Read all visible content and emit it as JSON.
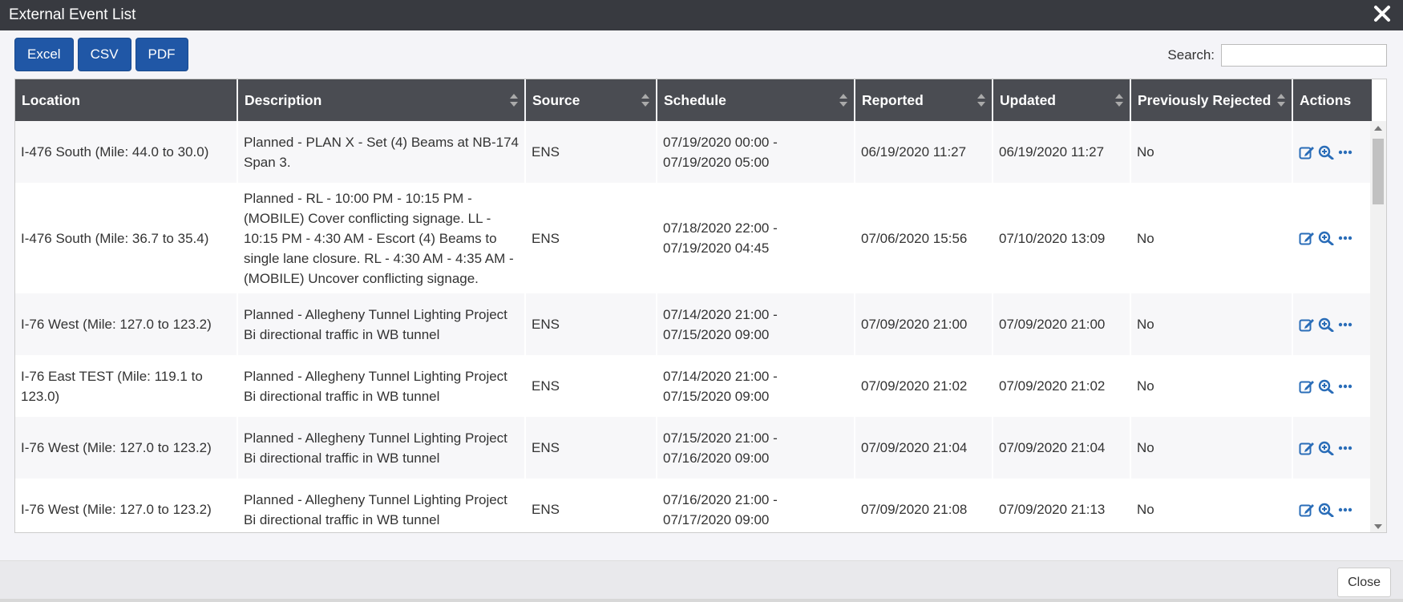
{
  "dialog": {
    "title": "External Event List",
    "close_icon": "close-icon"
  },
  "toolbar": {
    "buttons": [
      {
        "label": "Excel"
      },
      {
        "label": "CSV"
      },
      {
        "label": "PDF"
      }
    ]
  },
  "search": {
    "label": "Search:",
    "value": "",
    "placeholder": ""
  },
  "table": {
    "columns": [
      "Location",
      "Description",
      "Source",
      "Schedule",
      "Reported",
      "Updated",
      "Previously Rejected",
      "Actions"
    ],
    "rows": [
      {
        "location": "I-476 South (Mile: 44.0 to 30.0)",
        "description": "Planned - PLAN X - Set (4) Beams at NB-174 Span 3.",
        "source": "ENS",
        "schedule": "07/19/2020 00:00 - 07/19/2020 05:00",
        "reported": "06/19/2020 11:27",
        "updated": "06/19/2020 11:27",
        "rejected": "No"
      },
      {
        "location": "I-476 South (Mile: 36.7 to 35.4)",
        "description": "Planned - RL - 10:00 PM - 10:15 PM - (MOBILE) Cover conflicting signage. LL - 10:15 PM - 4:30 AM - Escort (4) Beams to single lane closure. RL - 4:30 AM - 4:35 AM - (MOBILE) Uncover conflicting signage.",
        "source": "ENS",
        "schedule": "07/18/2020 22:00 - 07/19/2020 04:45",
        "reported": "07/06/2020 15:56",
        "updated": "07/10/2020 13:09",
        "rejected": "No"
      },
      {
        "location": "I-76 West (Mile: 127.0 to 123.2)",
        "description": "Planned - Allegheny Tunnel Lighting Project Bi directional traffic in WB tunnel",
        "source": "ENS",
        "schedule": "07/14/2020 21:00 - 07/15/2020 09:00",
        "reported": "07/09/2020 21:00",
        "updated": "07/09/2020 21:00",
        "rejected": "No"
      },
      {
        "location": "I-76 East TEST (Mile: 119.1 to 123.0)",
        "description": "Planned - Allegheny Tunnel Lighting Project Bi directional traffic in WB tunnel",
        "source": "ENS",
        "schedule": "07/14/2020 21:00 - 07/15/2020 09:00",
        "reported": "07/09/2020 21:02",
        "updated": "07/09/2020 21:02",
        "rejected": "No"
      },
      {
        "location": "I-76 West (Mile: 127.0 to 123.2)",
        "description": "Planned - Allegheny Tunnel Lighting Project Bi directional traffic in WB tunnel",
        "source": "ENS",
        "schedule": "07/15/2020 21:00 - 07/16/2020 09:00",
        "reported": "07/09/2020 21:04",
        "updated": "07/09/2020 21:04",
        "rejected": "No"
      },
      {
        "location": "I-76 West (Mile: 127.0 to 123.2)",
        "description": "Planned - Allegheny Tunnel Lighting Project Bi directional traffic in WB tunnel",
        "source": "ENS",
        "schedule": "07/16/2020 21:00 - 07/17/2020 09:00",
        "reported": "07/09/2020 21:08",
        "updated": "07/09/2020 21:13",
        "rejected": "No"
      }
    ],
    "action_icons": [
      "edit-icon",
      "zoom-in-icon",
      "more-icon"
    ]
  },
  "footer": {
    "close_label": "Close"
  },
  "colors": {
    "titlebar": "#383a40",
    "header": "#4a4c52",
    "button": "#2057a6",
    "icon": "#2a6db8"
  }
}
